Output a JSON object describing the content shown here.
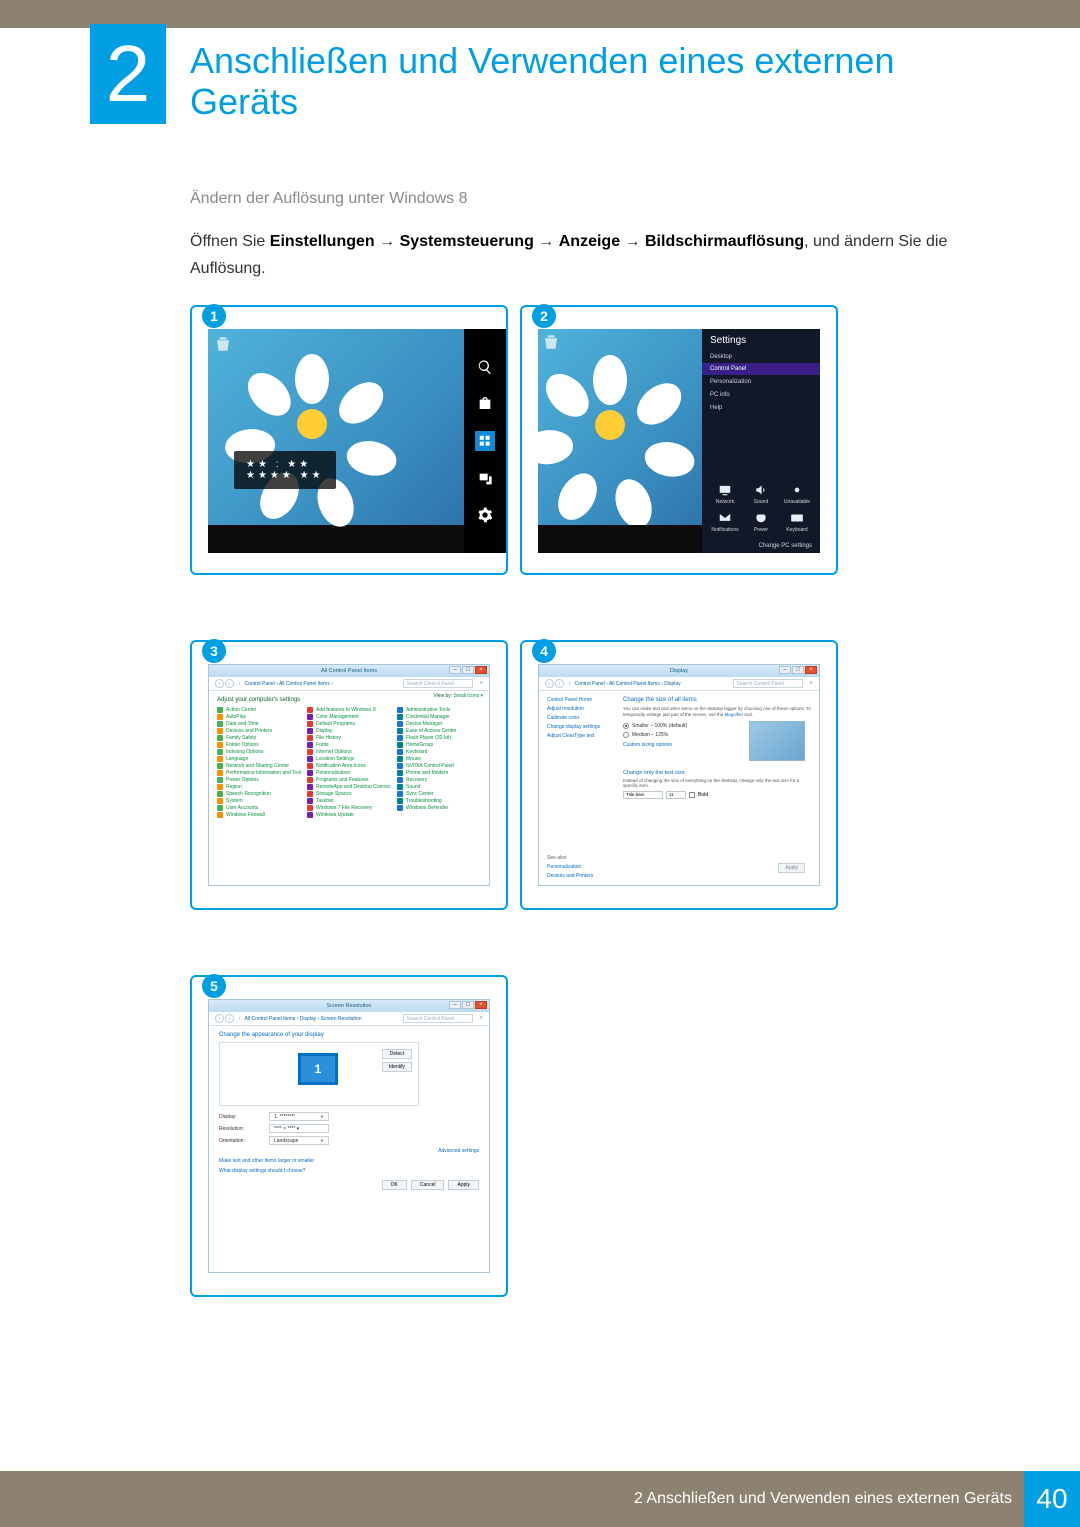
{
  "chapter": {
    "number": "2",
    "title": "Anschließen und Verwenden eines externen Geräts"
  },
  "section": {
    "sub": "Ändern der Auflösung unter Windows 8"
  },
  "body": {
    "prefix": "Öffnen Sie ",
    "path1": "Einstellungen",
    "path2": "Systemsteuerung",
    "path3": "Anzeige",
    "path4": "Bildschirmauflösung",
    "suffix": ", und ändern Sie die Auflösung."
  },
  "steps": {
    "n1": "1",
    "n2": "2",
    "n3": "3",
    "n4": "4",
    "n5": "5"
  },
  "shot1": {
    "time_top": "★★ : ★★",
    "time_bot": "★★★★ ★★",
    "recycle": "Recycle Bin",
    "charms": {
      "search": "Search",
      "share": "Share",
      "start": "Start",
      "devices": "Devices",
      "settings": "Settings"
    }
  },
  "shot2": {
    "panel_title": "Settings",
    "items": {
      "desktop": "Desktop",
      "control_panel": "Control Panel",
      "personalization": "Personalization",
      "pcinfo": "PC info",
      "help": "Help"
    },
    "icons": {
      "network": "Network",
      "sound": "Sound",
      "brightness": "Unavailable",
      "notifications": "Notifications",
      "power": "Power",
      "keyboard": "Keyboard"
    },
    "footer": "Change PC settings"
  },
  "shot3": {
    "title": "All Control Panel Items",
    "breadcrumb": "Control Panel  ›  All Control Panel Items  ›",
    "search_ph": "Search Control Panel",
    "heading": "Adjust your computer's settings",
    "viewby_label": "View by:",
    "viewby_value": "Small icons ▾",
    "items_col1": [
      "Action Center",
      "AutoPlay",
      "Date and Time",
      "Devices and Printers",
      "Family Safety",
      "Folder Options",
      "Indexing Options",
      "Language",
      "Network and Sharing Center",
      "Performance Information and Tools",
      "Power Options",
      "Region",
      "Speech Recognition",
      "System",
      "User Accounts",
      "Windows Firewall"
    ],
    "items_col2": [
      "Add features to Windows 8",
      "Color Management",
      "Default Programs",
      "Display",
      "File History",
      "Fonts",
      "Internet Options",
      "Location Settings",
      "Notification Area Icons",
      "Personalization",
      "Programs and Features",
      "RemoteApp and Desktop Connections",
      "Storage Spaces",
      "Taskbar",
      "Windows 7 File Recovery",
      "Windows Update"
    ],
    "items_col3": [
      "Administrative Tools",
      "Credential Manager",
      "Device Manager",
      "Ease of Access Center",
      "Flash Player (32-bit)",
      "HomeGroup",
      "Keyboard",
      "Mouse",
      "NVIDIA Control Panel",
      "Phone and Modem",
      "Recovery",
      "Sound",
      "Sync Center",
      "Troubleshooting",
      "Windows Defender"
    ]
  },
  "shot4": {
    "title": "Display",
    "breadcrumb": "Control Panel  ›  All Control Panel Items  ›  Display",
    "search_ph": "Search Control Panel",
    "side": {
      "home": "Control Panel Home",
      "res": "Adjust resolution",
      "color": "Calibrate color",
      "disp": "Change display settings",
      "clear": "Adjust ClearType text",
      "seealso": "See also",
      "pers": "Personalization",
      "devp": "Devices and Printers"
    },
    "heading": "Change the size of all items",
    "desc_a": "You can make text and other items on the desktop bigger by choosing one of these options. To temporarily enlarge just part of the screen, use the ",
    "desc_link": "Magnifier",
    "desc_b": " tool.",
    "opt_small": "Smaller – 100% (default)",
    "opt_med": "Medium – 125%",
    "custom_link": "Custom sizing options",
    "heading2": "Change only the text size",
    "desc2": "Instead of changing the size of everything on the desktop, change only the text size for a specific item.",
    "dd_label": "Title bars",
    "dd_size": "11",
    "bold": "Bold",
    "apply": "Apply"
  },
  "shot5": {
    "title": "Screen Resolution",
    "breadcrumb": "All Control Panel Items  ›  Display  ›  Screen Resolution",
    "search_ph": "Search Control Panel",
    "heading": "Change the appearance of your display",
    "monitor_num": "1",
    "detect": "Detect",
    "identify": "Identify",
    "row_display": "Display:",
    "row_display_val": "1. ********",
    "row_res": "Resolution:",
    "row_res_val": "**** × **** ▾",
    "row_orient": "Orientation:",
    "row_orient_val": "Landscape",
    "adv": "Advanced settings",
    "link1": "Make text and other items larger or smaller",
    "link2": "What display settings should I choose?",
    "ok": "OK",
    "cancel": "Cancel",
    "apply": "Apply"
  },
  "footer": {
    "label": "2 Anschließen und Verwenden eines externen Geräts",
    "page": "40"
  }
}
